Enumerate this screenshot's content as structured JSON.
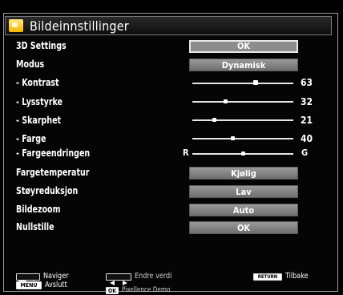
{
  "menu": {
    "title": "Bildeinnstillinger",
    "rows": [
      {
        "label": "3D Settings",
        "type": "button",
        "value": "OK",
        "selected": true
      },
      {
        "label": "Modus",
        "type": "button",
        "value": "Dynamisk"
      },
      {
        "label": "- Kontrast",
        "type": "slider",
        "value": "63",
        "level": 0.63
      },
      {
        "label": "- Lysstyrke",
        "type": "slider",
        "value": "32",
        "level": 0.32
      },
      {
        "label": "- Skarphet",
        "type": "slider",
        "value": "21",
        "level": 0.21
      },
      {
        "label": "- Farge",
        "type": "slider",
        "value": "40",
        "level": 0.4
      },
      {
        "label": "- Fargeendringen",
        "type": "balance",
        "left": "R",
        "right": "G",
        "level": 0.5
      },
      {
        "label": "Fargetemperatur",
        "type": "button",
        "value": "Kjølig"
      },
      {
        "label": "Støyreduksjon",
        "type": "button",
        "value": "Lav"
      },
      {
        "label": "Bildezoom",
        "type": "button",
        "value": "Auto"
      },
      {
        "label": "Nullstille",
        "type": "button",
        "value": "OK"
      }
    ]
  },
  "footer": {
    "navigate_label": "Naviger",
    "exit_key": "MENU",
    "exit_label": "Avslutt",
    "change_label": "Endre verdi",
    "demo_key": "OK",
    "demo_label": "Pixellence Demo",
    "return_key": "RETURN",
    "return_label": "Tilbake"
  }
}
